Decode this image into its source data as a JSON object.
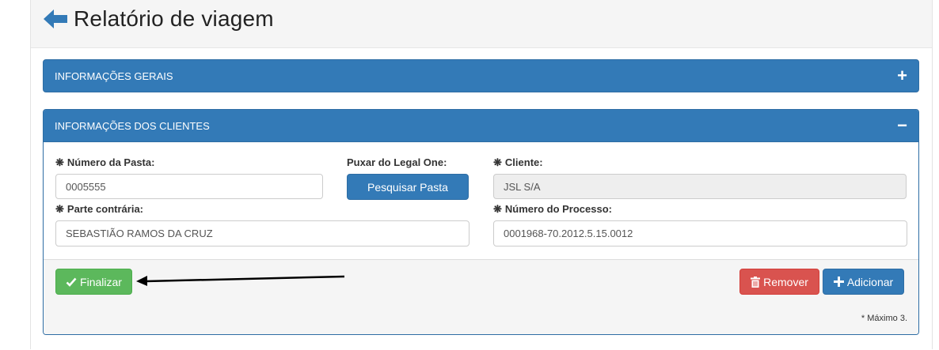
{
  "header": {
    "title": "Relatório de viagem"
  },
  "panels": {
    "general": {
      "title": "INFORMAÇÕES GERAIS",
      "toggle": "+"
    },
    "clients": {
      "title": "INFORMAÇÕES DOS CLIENTES",
      "toggle": "−"
    }
  },
  "form": {
    "required_mark": "❋",
    "pasta": {
      "label": "Número da Pasta:",
      "value": "0005555"
    },
    "legal_one": {
      "label": "Puxar do Legal One:",
      "button": "Pesquisar Pasta"
    },
    "cliente": {
      "label": "Cliente:",
      "value": "JSL S/A"
    },
    "parte": {
      "label": "Parte contrária:",
      "value": "SEBASTIÃO RAMOS DA CRUZ"
    },
    "processo": {
      "label": "Número do Processo:",
      "value": "0001968-70.2012.5.15.0012"
    }
  },
  "footer": {
    "finalizar": "Finalizar",
    "remover": "Remover",
    "adicionar": "Adicionar",
    "note": "* Máximo 3."
  },
  "colors": {
    "primary": "#337ab7",
    "success": "#5cb85c",
    "danger": "#d9534f"
  }
}
